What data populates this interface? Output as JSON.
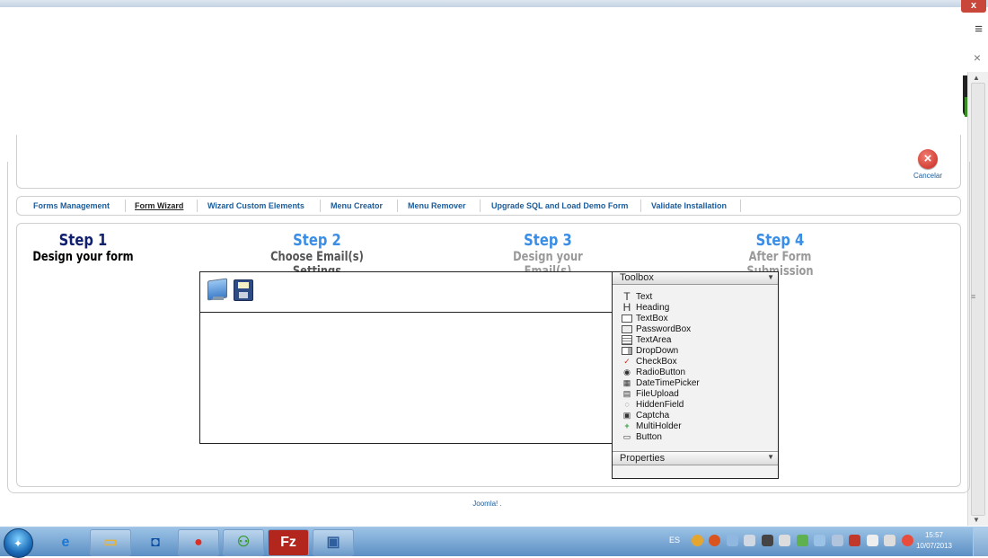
{
  "window": {
    "close_glyph": "x",
    "menu_glyph": "≡",
    "tab_close_glyph": "×"
  },
  "toolbar": {
    "cancel_label": "Cancelar"
  },
  "submenu": {
    "items": [
      {
        "label": "Forms Management"
      },
      {
        "label": "Form Wizard"
      },
      {
        "label": "Wizard Custom Elements"
      },
      {
        "label": "Menu Creator"
      },
      {
        "label": "Menu Remover"
      },
      {
        "label": "Upgrade SQL and Load Demo Form"
      },
      {
        "label": "Validate Installation"
      }
    ]
  },
  "steps": [
    {
      "title": "Step 1",
      "subtitle": "Design your form"
    },
    {
      "title": "Step 2",
      "subtitle": "Choose Email(s) Settings"
    },
    {
      "title": "Step 3",
      "subtitle": "Design your Email(s)"
    },
    {
      "title": "Step 4",
      "subtitle": "After Form Submission"
    }
  ],
  "toolbox": {
    "header": "Toolbox",
    "properties_header": "Properties",
    "items": [
      {
        "label": "Text",
        "icon": "T"
      },
      {
        "label": "Heading",
        "icon": "H"
      },
      {
        "label": "TextBox",
        "icon": ""
      },
      {
        "label": "PasswordBox",
        "icon": ""
      },
      {
        "label": "TextArea",
        "icon": ""
      },
      {
        "label": "DropDown",
        "icon": ""
      },
      {
        "label": "CheckBox",
        "icon": "✓"
      },
      {
        "label": "RadioButton",
        "icon": "◉"
      },
      {
        "label": "DateTimePicker",
        "icon": "▦"
      },
      {
        "label": "FileUpload",
        "icon": "▤"
      },
      {
        "label": "HiddenField",
        "icon": "◌"
      },
      {
        "label": "Captcha",
        "icon": "▣"
      },
      {
        "label": "MultiHolder",
        "icon": "+"
      },
      {
        "label": "Button",
        "icon": "▭"
      }
    ]
  },
  "footer": {
    "text": "Joomla! ."
  },
  "taskbar": {
    "language": "ES",
    "time": "15:57",
    "date": "10/07/2013",
    "filezilla_glyph": "Fz"
  },
  "colors": {
    "step_active": "#101f6e",
    "step_next": "#3a8ee6",
    "link": "#1b5c9a"
  }
}
